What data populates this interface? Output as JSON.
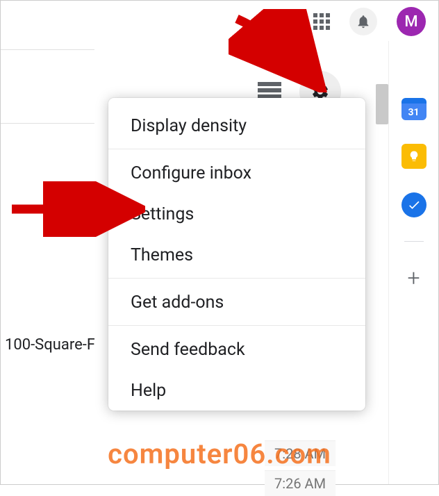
{
  "header": {
    "avatar_letter": "M"
  },
  "menu": {
    "items": [
      "Display density",
      "Configure inbox",
      "Settings",
      "Themes",
      "Get add-ons",
      "Send feedback",
      "Help"
    ]
  },
  "list": {
    "partial_subject": "100-Square-F"
  },
  "sidepanel": {
    "calendar_day": "31"
  },
  "times": {
    "a": "7:28 AM",
    "b": "7:26 AM"
  },
  "watermark": "computer06.com"
}
